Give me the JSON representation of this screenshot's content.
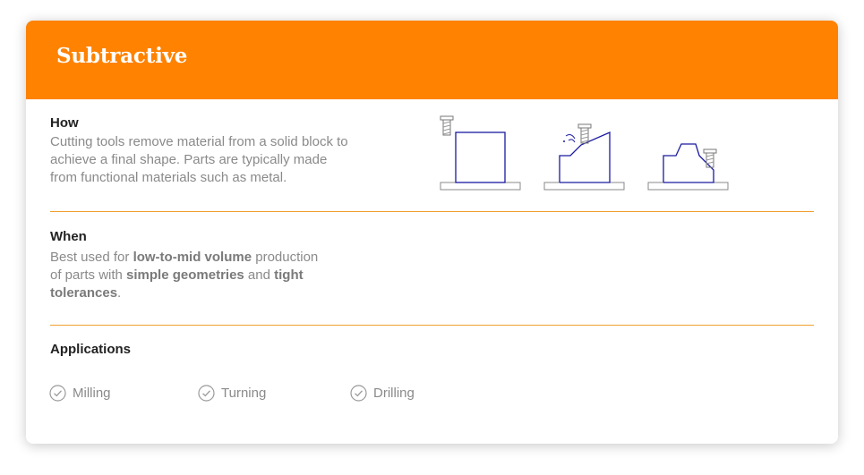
{
  "header": {
    "title": "Subtractive",
    "color": "#ff8200"
  },
  "how": {
    "heading": "How",
    "line1": "Cutting tools remove material from a solid block to",
    "line2": "achieve a final shape. Parts are typically made",
    "line3": "from functional materials such as metal."
  },
  "when": {
    "heading": "When",
    "l1_pre": "Best used for ",
    "l1_bold": "low-to-mid volume",
    "l1_post": " production",
    "l2_pre": "of parts with ",
    "l2_bold1": "simple geometries",
    "l2_mid": " and ",
    "l2_bold2": "tight",
    "l3_bold": "tolerances",
    "l3_post": "."
  },
  "applications": {
    "heading": "Applications",
    "items": [
      {
        "label": "Milling",
        "icon": "check-circle-icon"
      },
      {
        "label": "Turning",
        "icon": "check-circle-icon"
      },
      {
        "label": "Drilling",
        "icon": "check-circle-icon"
      }
    ]
  },
  "colors": {
    "accent": "#ff8200",
    "divider": "#f0a030",
    "illustration": "#1a1aa0"
  }
}
